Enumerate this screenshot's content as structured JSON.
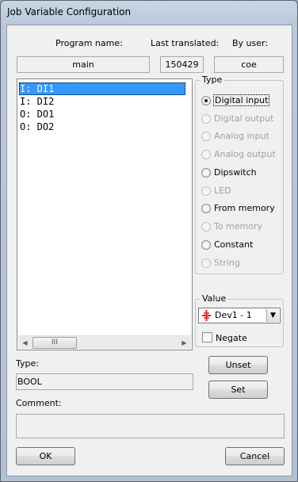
{
  "window": {
    "title": "Job Variable Configuration"
  },
  "header": {
    "program_name_label": "Program name:",
    "last_translated_label": "Last translated:",
    "by_user_label": "By user:",
    "program_name_value": "main",
    "last_translated_value": "150429",
    "by_user_value": "coe"
  },
  "variables": [
    {
      "text": "I:  DI1",
      "selected": true
    },
    {
      "text": "I:  DI2",
      "selected": false
    },
    {
      "text": "O:  DO1",
      "selected": false
    },
    {
      "text": "O:  DO2",
      "selected": false
    }
  ],
  "scrollbar": {
    "left_arrow": "◀",
    "thumb_grip": "III",
    "right_arrow": "▶"
  },
  "type_group": {
    "title": "Type",
    "options": [
      {
        "label": "Digital input",
        "enabled": true,
        "checked": true
      },
      {
        "label": "Digital output",
        "enabled": false,
        "checked": false
      },
      {
        "label": "Analog input",
        "enabled": false,
        "checked": false
      },
      {
        "label": "Analog output",
        "enabled": false,
        "checked": false
      },
      {
        "label": "Dipswitch",
        "enabled": true,
        "checked": false
      },
      {
        "label": "LED",
        "enabled": false,
        "checked": false
      },
      {
        "label": "From memory",
        "enabled": true,
        "checked": false
      },
      {
        "label": "To memory",
        "enabled": false,
        "checked": false
      },
      {
        "label": "Constant",
        "enabled": true,
        "checked": false
      },
      {
        "label": "String",
        "enabled": false,
        "checked": false
      }
    ]
  },
  "value_group": {
    "title": "Value",
    "selected": "Dev1 - 1",
    "negate_label": "Negate",
    "negate_checked": false
  },
  "type_field": {
    "label": "Type:",
    "value": "BOOL"
  },
  "comment_field": {
    "label": "Comment:",
    "value": ""
  },
  "buttons": {
    "unset": "Unset",
    "set": "Set",
    "ok": "OK",
    "cancel": "Cancel"
  },
  "colors": {
    "selection": "#3399ff",
    "device_icon": "#e02020",
    "disabled_text": "#a0a0a0"
  }
}
